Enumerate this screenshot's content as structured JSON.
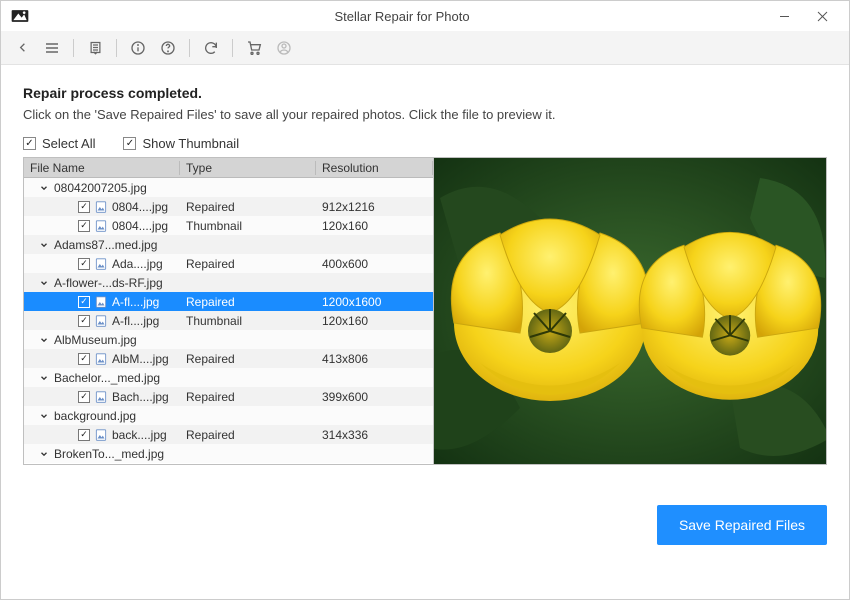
{
  "window": {
    "title": "Stellar Repair for Photo"
  },
  "messages": {
    "heading": "Repair process completed.",
    "subheading": "Click on the 'Save Repaired Files' to save all your repaired photos. Click the file to preview it."
  },
  "options": {
    "select_all": {
      "label": "Select All",
      "checked": true
    },
    "show_thumbnail": {
      "label": "Show Thumbnail",
      "checked": true
    }
  },
  "columns": {
    "name": "File Name",
    "type": "Type",
    "resolution": "Resolution"
  },
  "tree": [
    {
      "kind": "group",
      "expanded": true,
      "name": "08042007205.jpg"
    },
    {
      "kind": "child",
      "checked": true,
      "name": "0804....jpg",
      "type": "Repaired",
      "res": "912x1216"
    },
    {
      "kind": "child",
      "checked": true,
      "name": "0804....jpg",
      "type": "Thumbnail",
      "res": "120x160"
    },
    {
      "kind": "group",
      "expanded": true,
      "name": "Adams87...med.jpg"
    },
    {
      "kind": "child",
      "checked": true,
      "name": "Ada....jpg",
      "type": "Repaired",
      "res": "400x600"
    },
    {
      "kind": "group",
      "expanded": true,
      "name": "A-flower-...ds-RF.jpg"
    },
    {
      "kind": "child",
      "checked": true,
      "name": "A-fl....jpg",
      "type": "Repaired",
      "res": "1200x1600",
      "selected": true
    },
    {
      "kind": "child",
      "checked": true,
      "name": "A-fl....jpg",
      "type": "Thumbnail",
      "res": "120x160"
    },
    {
      "kind": "group",
      "expanded": true,
      "name": "AlbMuseum.jpg"
    },
    {
      "kind": "child",
      "checked": true,
      "name": "AlbM....jpg",
      "type": "Repaired",
      "res": "413x806"
    },
    {
      "kind": "group",
      "expanded": true,
      "name": "Bachelor..._med.jpg"
    },
    {
      "kind": "child",
      "checked": true,
      "name": "Bach....jpg",
      "type": "Repaired",
      "res": "399x600"
    },
    {
      "kind": "group",
      "expanded": true,
      "name": "background.jpg"
    },
    {
      "kind": "child",
      "checked": true,
      "name": "back....jpg",
      "type": "Repaired",
      "res": "314x336"
    },
    {
      "kind": "group",
      "expanded": true,
      "name": "BrokenTo..._med.jpg"
    }
  ],
  "buttons": {
    "save": "Save Repaired Files"
  }
}
